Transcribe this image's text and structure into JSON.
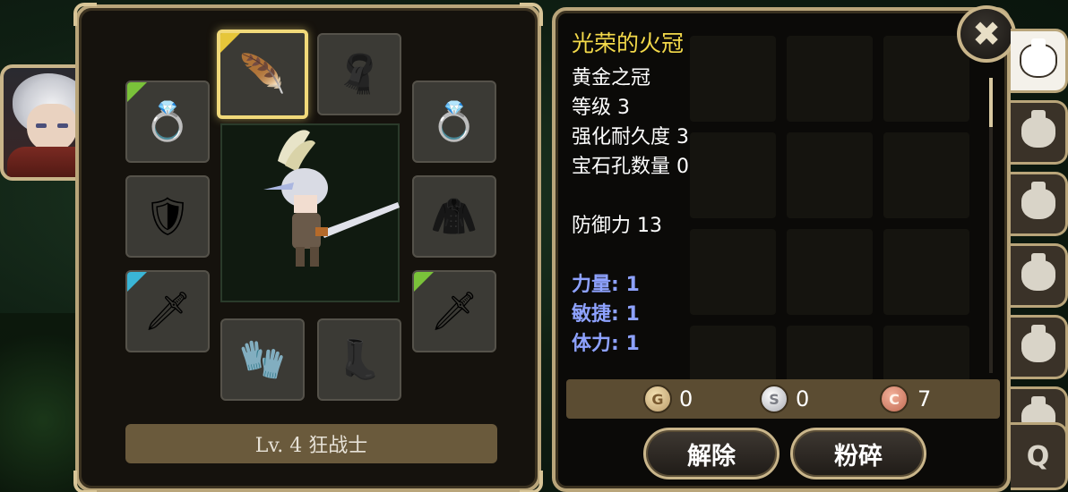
{
  "character": {
    "level_class": "Lv. 4 狂战士"
  },
  "equipment_slots": [
    {
      "slot": "helmet",
      "icon": "feather-crown-icon",
      "glyph": "🪶",
      "selected": true,
      "corner": "yellow"
    },
    {
      "slot": "cape",
      "icon": "cape-silhouette-icon",
      "glyph": "🧣",
      "selected": false,
      "corner": ""
    },
    {
      "slot": "ring-left",
      "icon": "gold-ring-icon",
      "glyph": "💍",
      "selected": false,
      "corner": "green"
    },
    {
      "slot": "ring-right",
      "icon": "gold-ring-icon",
      "glyph": "💍",
      "selected": false,
      "corner": ""
    },
    {
      "slot": "armor",
      "icon": "armor-icon",
      "glyph": "🛡",
      "selected": false,
      "corner": ""
    },
    {
      "slot": "coat",
      "icon": "coat-silhouette-icon",
      "glyph": "🧥",
      "selected": false,
      "corner": ""
    },
    {
      "slot": "offhand",
      "icon": "dagger-icon",
      "glyph": "🗡",
      "selected": false,
      "corner": "cyan"
    },
    {
      "slot": "weapon",
      "icon": "sword-icon",
      "glyph": "🗡",
      "selected": false,
      "corner": "green"
    },
    {
      "slot": "gloves",
      "icon": "glove-icon",
      "glyph": "🧤",
      "selected": false,
      "corner": ""
    },
    {
      "slot": "boots",
      "icon": "boot-silhouette-icon",
      "glyph": "👢",
      "selected": false,
      "corner": ""
    }
  ],
  "item_info": {
    "title": "光荣的火冠",
    "lines": [
      "黄金之冠",
      "等级 3",
      "强化耐久度 3",
      "宝石孔数量 0"
    ],
    "defense": "防御力 13",
    "stats": [
      "力量: 1",
      "敏捷: 1",
      "体力: 1"
    ]
  },
  "currency": {
    "gold": "0",
    "silver": "0",
    "copper": "7",
    "gold_mark": "G",
    "silver_mark": "S",
    "copper_mark": "C"
  },
  "buttons": {
    "unequip": "解除",
    "destroy": "粉碎"
  },
  "close_glyph": "✖",
  "tabs": {
    "search_glyph": "Q"
  },
  "colors": {
    "title": "#f3d94a",
    "stat": "#8ea2ff",
    "frame": "#b9a57a",
    "selected_slot": "#f1d97a"
  }
}
